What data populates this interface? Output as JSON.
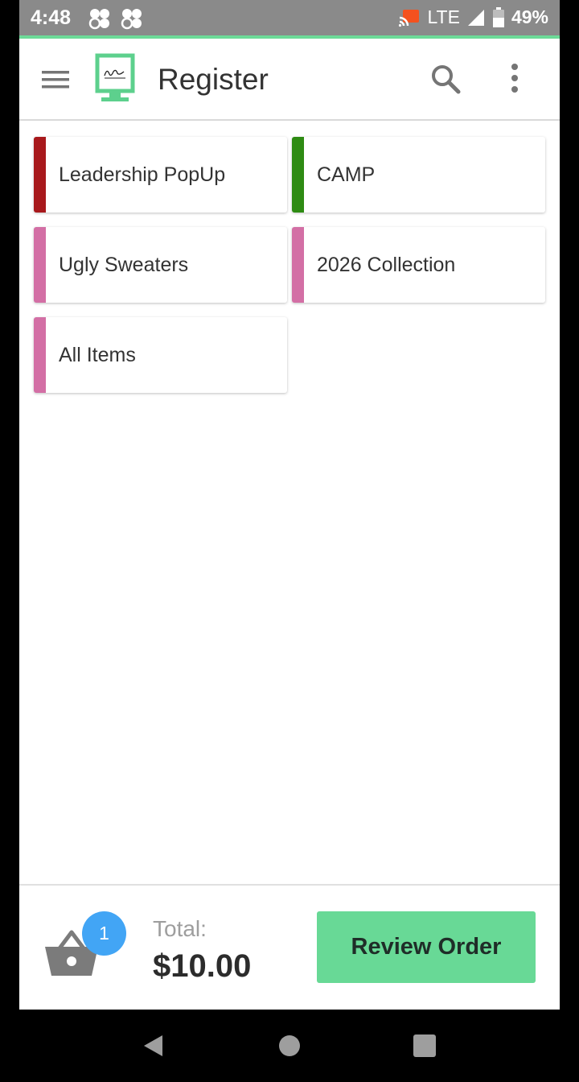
{
  "status_bar": {
    "time": "4:48",
    "network": "LTE",
    "battery": "49%"
  },
  "app_bar": {
    "title": "Register"
  },
  "categories": [
    {
      "label": "Leadership PopUp",
      "color": "#a8191c"
    },
    {
      "label": "CAMP",
      "color": "#2e8b13"
    },
    {
      "label": "Ugly Sweaters",
      "color": "#d36fa5"
    },
    {
      "label": "2026 Collection",
      "color": "#d36fa5"
    },
    {
      "label": "All Items",
      "color": "#d36fa5"
    }
  ],
  "cart": {
    "count": "1",
    "total_label": "Total:",
    "total_value": "$10.00",
    "review_label": "Review Order"
  },
  "colors": {
    "accent": "#68d996",
    "badge": "#42a5f5"
  }
}
